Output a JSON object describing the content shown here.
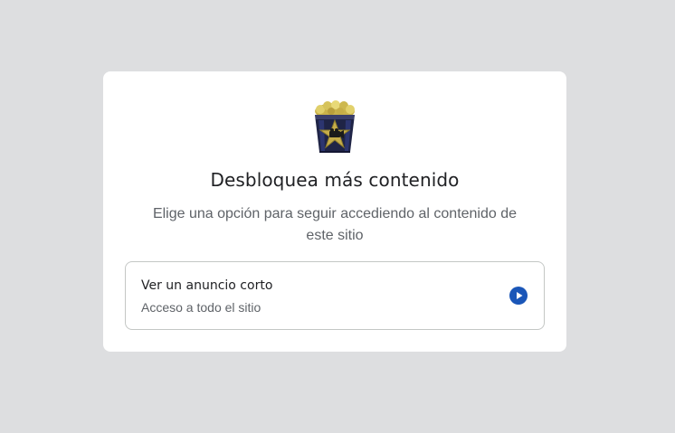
{
  "dialog": {
    "logo_icon": "popcorn-bucket-icon",
    "title": "Desbloquea más contenido",
    "subtitle": "Elige una opción para seguir accediendo al contenido de este sitio",
    "options": [
      {
        "title": "Ver un anuncio corto",
        "description": "Acceso a todo el sitio",
        "icon": "play-circle-icon"
      }
    ]
  },
  "colors": {
    "background": "#dddee0",
    "accent": "#1a56b8"
  }
}
